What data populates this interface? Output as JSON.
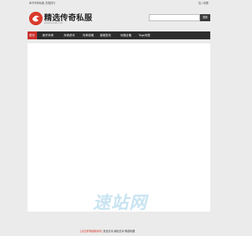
{
  "topbar": {
    "left_text": "奉节传奇私服_热搜排行",
    "right_text": "加入收藏"
  },
  "logo": {
    "title": "精选传奇私服",
    "subtitle": "www.bncsp.com"
  },
  "search": {
    "placeholder": "",
    "button_label": "搜索"
  },
  "nav": {
    "items": [
      {
        "label": "首页"
      },
      {
        "label": "新开传奇"
      },
      {
        "label": "传奇资讯"
      },
      {
        "label": "传奇攻略"
      },
      {
        "label": "新服发布"
      },
      {
        "label": "玩服必备"
      },
      {
        "label": "Tags列表"
      }
    ]
  },
  "watermark": {
    "text": "速站网"
  },
  "footer": {
    "highlight": "[点击获得最新版本]",
    "text": " 安全无毒 绿色无毒 畅游玩服"
  },
  "colors": {
    "accent": "#c9302c",
    "nav_bg": "#2d2d2d",
    "page_bg": "#ebebeb"
  }
}
